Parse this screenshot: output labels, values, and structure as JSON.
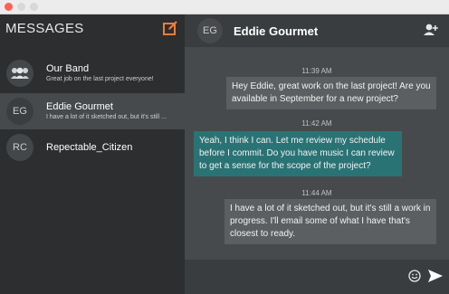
{
  "window": {
    "close_color": "#ff5f57"
  },
  "sidebar": {
    "title": "MESSAGES",
    "compose_icon": "compose-icon",
    "accent": "#f07c3a",
    "conversations": [
      {
        "initials": "",
        "name": "Our Band",
        "preview": "Great job on the last project everyone!",
        "icon": "group-icon"
      },
      {
        "initials": "EG",
        "name": "Eddie Gourmet",
        "preview": "I have a lot of it sketched out, but it's still ...",
        "active": true
      },
      {
        "initials": "RC",
        "name": "Repectable_Citizen",
        "preview": ""
      }
    ]
  },
  "chat": {
    "initials": "EG",
    "name": "Eddie Gourmet",
    "add_user_icon": "add-user-icon",
    "messages": [
      {
        "time": "11:39 AM",
        "text": "Hey Eddie, great work on the last project! Are you available in September for a new project?",
        "direction": "out"
      },
      {
        "time": "11:42 AM",
        "text": "Yeah, I think I can. Let me review my schedule before I commit. Do you have music I can review to get a sense for the scope of the project?",
        "direction": "in"
      },
      {
        "time": "11:44 AM",
        "text": "I have a lot of it sketched out, but it's still a work in progress. I'll email some of what I have that's closest to ready.",
        "direction": "out"
      }
    ],
    "incoming_color": "#2a7375",
    "emoji_icon": "emoji-icon",
    "send_icon": "send-icon"
  }
}
